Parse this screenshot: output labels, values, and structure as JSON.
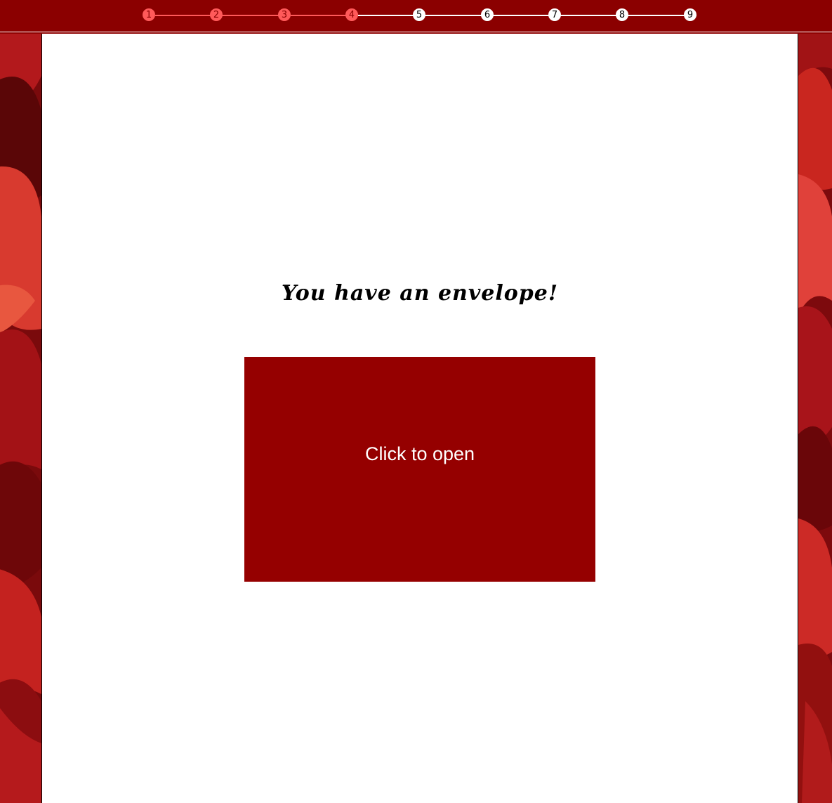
{
  "progress": {
    "steps": [
      "1",
      "2",
      "3",
      "4",
      "5",
      "6",
      "7",
      "8",
      "9"
    ],
    "completed_count": 4,
    "colors": {
      "completed": "#ff5a5a",
      "pending": "#ffffff",
      "bar_background": "#8b0000"
    }
  },
  "main": {
    "heading": "You have an envelope!",
    "envelope": {
      "label": "Click to open",
      "color": "#950000"
    }
  },
  "decor": {
    "side_panels": "rose-petals-image"
  }
}
